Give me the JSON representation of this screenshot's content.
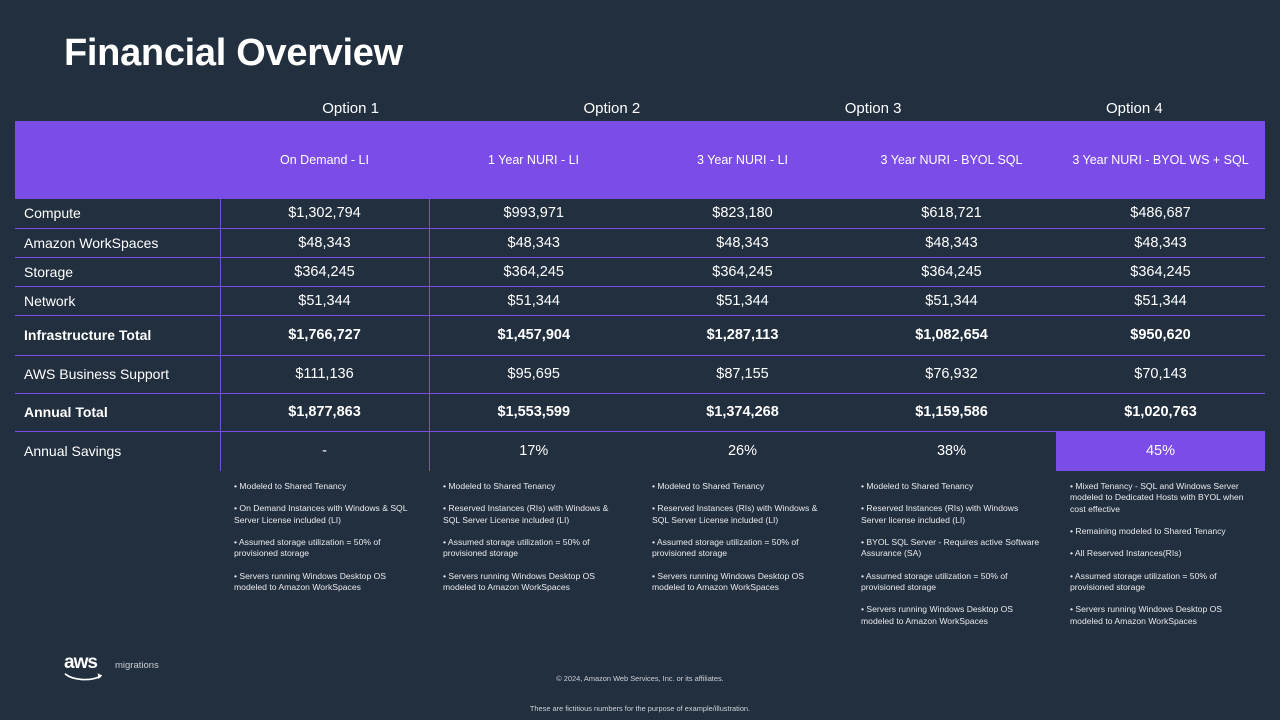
{
  "title": "Financial Overview",
  "options": [
    {
      "tag": "Option 1",
      "scenario": "On Demand - LI"
    },
    {
      "tag": "Option 2",
      "scenario": "1 Year NURI - LI"
    },
    {
      "tag": "Option 3",
      "scenario": "3 Year NURI - LI"
    },
    {
      "tag": "Option 4",
      "scenario": "3 Year NURI - BYOL SQL"
    }
  ],
  "header": {
    "option_tags": [
      "Option 1",
      "Option 2",
      "Option 3",
      "Option 4"
    ],
    "scenarios": [
      "On Demand - LI",
      "1 Year NURI - LI",
      "3 Year NURI - LI",
      "3 Year NURI - BYOL SQL",
      "3 Year NURI - BYOL WS + SQL"
    ]
  },
  "table": {
    "rows": [
      {
        "label": "Compute",
        "values": [
          "$1,302,794",
          "$993,971",
          "$823,180",
          "$618,721",
          "$486,687"
        ]
      },
      {
        "label": "Amazon WorkSpaces",
        "values": [
          "$48,343",
          "$48,343",
          "$48,343",
          "$48,343",
          "$48,343"
        ]
      },
      {
        "label": "Storage",
        "values": [
          "$364,245",
          "$364,245",
          "$364,245",
          "$364,245",
          "$364,245"
        ]
      },
      {
        "label": "Network",
        "values": [
          "$51,344",
          "$51,344",
          "$51,344",
          "$51,344",
          "$51,344"
        ]
      },
      {
        "label": "Infrastructure Total",
        "values": [
          "$1,766,727",
          "$1,457,904",
          "$1,287,113",
          "$1,082,654",
          "$950,620"
        ]
      },
      {
        "label": "AWS Business Support",
        "values": [
          "$111,136",
          "$95,695",
          "$87,155",
          "$76,932",
          "$70,143"
        ]
      },
      {
        "label": "Annual Total",
        "values": [
          "$1,877,863",
          "$1,553,599",
          "$1,374,268",
          "$1,159,586",
          "$1,020,763"
        ]
      },
      {
        "label": "Annual Savings",
        "values": [
          "-",
          "17%",
          "26%",
          "38%",
          "45%"
        ]
      }
    ]
  },
  "notes": {
    "columns": [
      [
        "• Modeled to Shared Tenancy",
        "• On Demand Instances with Windows & SQL Server License included (LI)",
        "• Assumed storage utilization = 50% of provisioned storage",
        "• Servers running Windows Desktop OS modeled to Amazon WorkSpaces"
      ],
      [
        "• Modeled to Shared Tenancy",
        "• Reserved Instances (RIs) with Windows & SQL Server License included (LI)",
        "• Assumed storage utilization = 50% of provisioned storage",
        "• Servers running Windows Desktop OS modeled to Amazon WorkSpaces"
      ],
      [
        "• Modeled to Shared Tenancy",
        "• Reserved Instances (RIs) with Windows & SQL Server License included (LI)",
        "• Assumed storage utilization = 50% of provisioned storage",
        "• Servers running Windows Desktop OS modeled to Amazon WorkSpaces"
      ],
      [
        "• Modeled to Shared Tenancy",
        "• Reserved Instances (RIs) with Windows Server license included (LI)",
        "• BYOL SQL Server - Requires active Software Assurance (SA)",
        "• Assumed storage utilization = 50% of provisioned storage",
        "• Servers running Windows Desktop OS modeled to Amazon WorkSpaces"
      ],
      [
        "• Mixed Tenancy - SQL and Windows Server modeled to Dedicated Hosts with BYOL when cost effective",
        "• Remaining modeled to Shared Tenancy",
        "• All Reserved Instances(RIs)",
        "• Assumed storage utilization = 50% of provisioned storage",
        "• Servers running Windows Desktop OS modeled to Amazon WorkSpaces"
      ]
    ]
  },
  "footer": {
    "logo_word": "aws",
    "logo_sub": "migrations",
    "copyright": "© 2024, Amazon Web Services, Inc. or its affiliates.",
    "disclaimer": "These are fictitious numbers for the purpose of example/illustration."
  },
  "colors": {
    "background": "#222f3e",
    "accent_purple": "#7b4ce8",
    "text": "#ffffff"
  }
}
